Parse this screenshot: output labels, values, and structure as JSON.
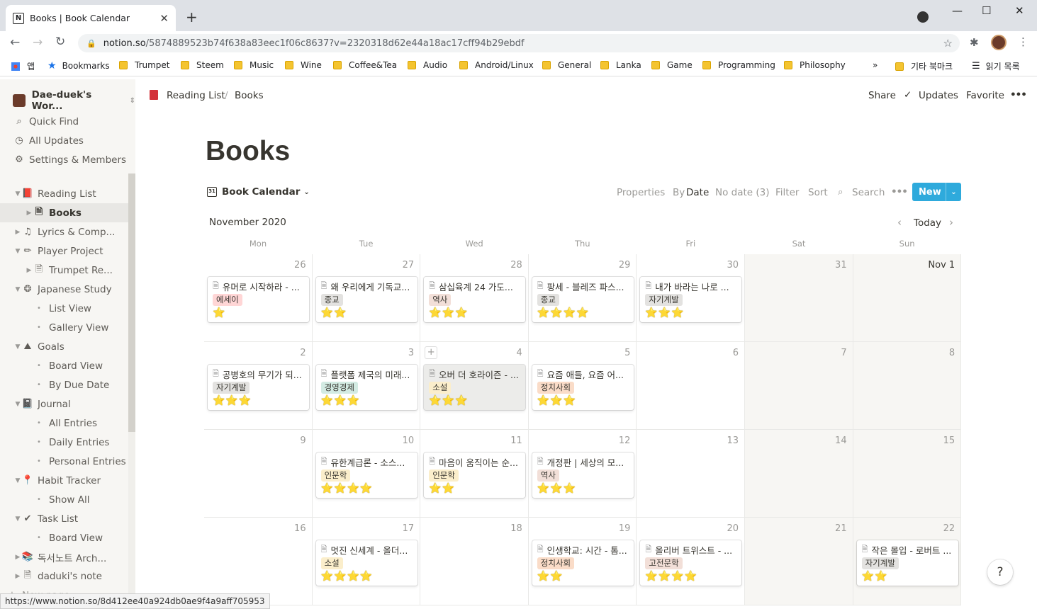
{
  "browser": {
    "tab_title": "Books | Book Calendar",
    "tab_favicon": "N",
    "url_host": "notion.so",
    "url_path": "/5874889523b74f638a83eec1f06c8637?v=2320318d62e44a18ac17cff94b29ebdf",
    "new_tab": "+",
    "minimize": "—",
    "maximize": "☐",
    "close": "✕",
    "bookmarks": [
      "앱",
      "Bookmarks",
      "Trumpet",
      "Steem",
      "Music",
      "Wine",
      "Coffee&Tea",
      "Audio",
      "Android/Linux",
      "General",
      "Lanka",
      "Game",
      "Programming",
      "Philosophy"
    ],
    "bookmarks_more": "»",
    "other_bookmarks": "기타 북마크",
    "reading_list": "읽기 목록",
    "status_url": "https://www.notion.so/8d412ee40a924db0ae9f4a9aff705953"
  },
  "sidebar": {
    "workspace": "Dae-duek's Wor...",
    "top": [
      "Quick Find",
      "All Updates",
      "Settings & Members"
    ],
    "items": [
      {
        "label": "Reading List",
        "icon": "📕",
        "level": 0,
        "tri": "▼"
      },
      {
        "label": "Books",
        "icon": "🗎",
        "level": 1,
        "tri": "▶",
        "active": true
      },
      {
        "label": "Lyrics & Comp...",
        "icon": "♫",
        "level": 0,
        "tri": "▶"
      },
      {
        "label": "Player Project",
        "icon": "✏",
        "level": 0,
        "tri": "▼"
      },
      {
        "label": "Trumpet Re...",
        "icon": "🗎",
        "level": 1,
        "tri": "▶"
      },
      {
        "label": "Japanese Study",
        "icon": "❂",
        "level": 0,
        "tri": "▼"
      },
      {
        "label": "List View",
        "icon": "•",
        "level": 1,
        "tri": ""
      },
      {
        "label": "Gallery View",
        "icon": "•",
        "level": 1,
        "tri": ""
      },
      {
        "label": "Goals",
        "icon": "⛰",
        "level": 0,
        "tri": "▼"
      },
      {
        "label": "Board View",
        "icon": "•",
        "level": 1,
        "tri": ""
      },
      {
        "label": "By Due Date",
        "icon": "•",
        "level": 1,
        "tri": ""
      },
      {
        "label": "Journal",
        "icon": "📓",
        "level": 0,
        "tri": "▼"
      },
      {
        "label": "All Entries",
        "icon": "•",
        "level": 1,
        "tri": ""
      },
      {
        "label": "Daily Entries",
        "icon": "•",
        "level": 1,
        "tri": ""
      },
      {
        "label": "Personal Entries",
        "icon": "•",
        "level": 1,
        "tri": ""
      },
      {
        "label": "Habit Tracker",
        "icon": "📍",
        "level": 0,
        "tri": "▼"
      },
      {
        "label": "Show All",
        "icon": "•",
        "level": 1,
        "tri": ""
      },
      {
        "label": "Task List",
        "icon": "✔",
        "level": 0,
        "tri": "▼"
      },
      {
        "label": "Board View",
        "icon": "•",
        "level": 1,
        "tri": ""
      },
      {
        "label": "독서노트 Arch...",
        "icon": "📚",
        "level": 0,
        "tri": "▶"
      },
      {
        "label": "daduki's note",
        "icon": "🗎",
        "level": 0,
        "tri": "▶"
      }
    ],
    "new_page": "New page"
  },
  "topbar": {
    "breadcrumb": [
      "Reading List",
      "Books"
    ],
    "breadcrumb_sep": "/",
    "share": "Share",
    "updates": "Updates",
    "favorite": "Favorite",
    "more": "•••"
  },
  "page": {
    "title": "Books",
    "view_name": "Book Calendar",
    "toolbar": {
      "properties": "Properties",
      "by": "By",
      "date": "Date",
      "no_date": "No date (3)",
      "filter": "Filter",
      "sort": "Sort",
      "search": "Search",
      "more": "•••",
      "new": "New"
    },
    "month": "November 2020",
    "today": "Today"
  },
  "calendar": {
    "weekdays": [
      "Mon",
      "Tue",
      "Wed",
      "Thu",
      "Fri",
      "Sat",
      "Sun"
    ],
    "weeks": [
      [
        "26",
        "27",
        "28",
        "29",
        "30",
        "31",
        "Nov 1"
      ],
      [
        "2",
        "3",
        "4",
        "5",
        "6",
        "7",
        "8"
      ],
      [
        "9",
        "10",
        "11",
        "12",
        "13",
        "14",
        "15"
      ],
      [
        "16",
        "17",
        "18",
        "19",
        "20",
        "21",
        "22"
      ]
    ],
    "cards": [
      {
        "week": 0,
        "day": 0,
        "title": "유머로 시작하라 - ...",
        "tag": "에세이",
        "tag_bg": "#ffd6d6",
        "stars": "⭐"
      },
      {
        "week": 0,
        "day": 1,
        "title": "왜 우리에게 기독교...",
        "tag": "종교",
        "tag_bg": "#e3e2e0",
        "stars": "⭐⭐"
      },
      {
        "week": 0,
        "day": 2,
        "title": "삼십육계 24 가도...",
        "tag": "역사",
        "tag_bg": "#f2dfd8",
        "stars": "⭐⭐⭐"
      },
      {
        "week": 0,
        "day": 3,
        "title": "팡세 - 블레즈 파스...",
        "tag": "종교",
        "tag_bg": "#e3e2e0",
        "stars": "⭐⭐⭐⭐"
      },
      {
        "week": 0,
        "day": 4,
        "title": "내가 바라는 나로 ...",
        "tag": "자기계발",
        "tag_bg": "#e3e2e0",
        "stars": "⭐⭐⭐"
      },
      {
        "week": 1,
        "day": 0,
        "title": "공병호의 무기가 되...",
        "tag": "자기계발",
        "tag_bg": "#e3e2e0",
        "stars": "⭐⭐⭐"
      },
      {
        "week": 1,
        "day": 1,
        "title": "플랫폼 제국의 미래...",
        "tag": "경영경제",
        "tag_bg": "#d3ebe3",
        "stars": "⭐⭐⭐"
      },
      {
        "week": 1,
        "day": 2,
        "title": "오버 더 호라이즌 - ...",
        "tag": "소설",
        "tag_bg": "#fbeecb",
        "stars": "⭐⭐⭐",
        "highlight": true
      },
      {
        "week": 1,
        "day": 3,
        "title": "요즘 애들, 요즘 어...",
        "tag": "정치사회",
        "tag_bg": "#fadcc8",
        "stars": "⭐⭐⭐"
      },
      {
        "week": 2,
        "day": 1,
        "title": "유한계급론 - 소스...",
        "tag": "인문학",
        "tag_bg": "#fbeecb",
        "stars": "⭐⭐⭐⭐"
      },
      {
        "week": 2,
        "day": 2,
        "title": "마음이 움직이는 순...",
        "tag": "인문학",
        "tag_bg": "#fbeecb",
        "stars": "⭐⭐"
      },
      {
        "week": 2,
        "day": 3,
        "title": "개정판 | 세상의 모...",
        "tag": "역사",
        "tag_bg": "#f2dfd8",
        "stars": "⭐⭐⭐"
      },
      {
        "week": 3,
        "day": 1,
        "title": "멋진 신세계 - 올더...",
        "tag": "소설",
        "tag_bg": "#fbeecb",
        "stars": "⭐⭐⭐⭐"
      },
      {
        "week": 3,
        "day": 3,
        "title": "인생학교: 시간 - 톰...",
        "tag": "정치사회",
        "tag_bg": "#fadcc8",
        "stars": "⭐⭐"
      },
      {
        "week": 3,
        "day": 4,
        "title": "올리버 트위스트 - ...",
        "tag": "고전문학",
        "tag_bg": "#f2dfd8",
        "stars": "⭐⭐⭐⭐"
      },
      {
        "week": 3,
        "day": 6,
        "title": "작은 몰입 - 로버트 ...",
        "tag": "자기계발",
        "tag_bg": "#e3e2e0",
        "stars": "⭐⭐"
      }
    ]
  },
  "help": "?"
}
